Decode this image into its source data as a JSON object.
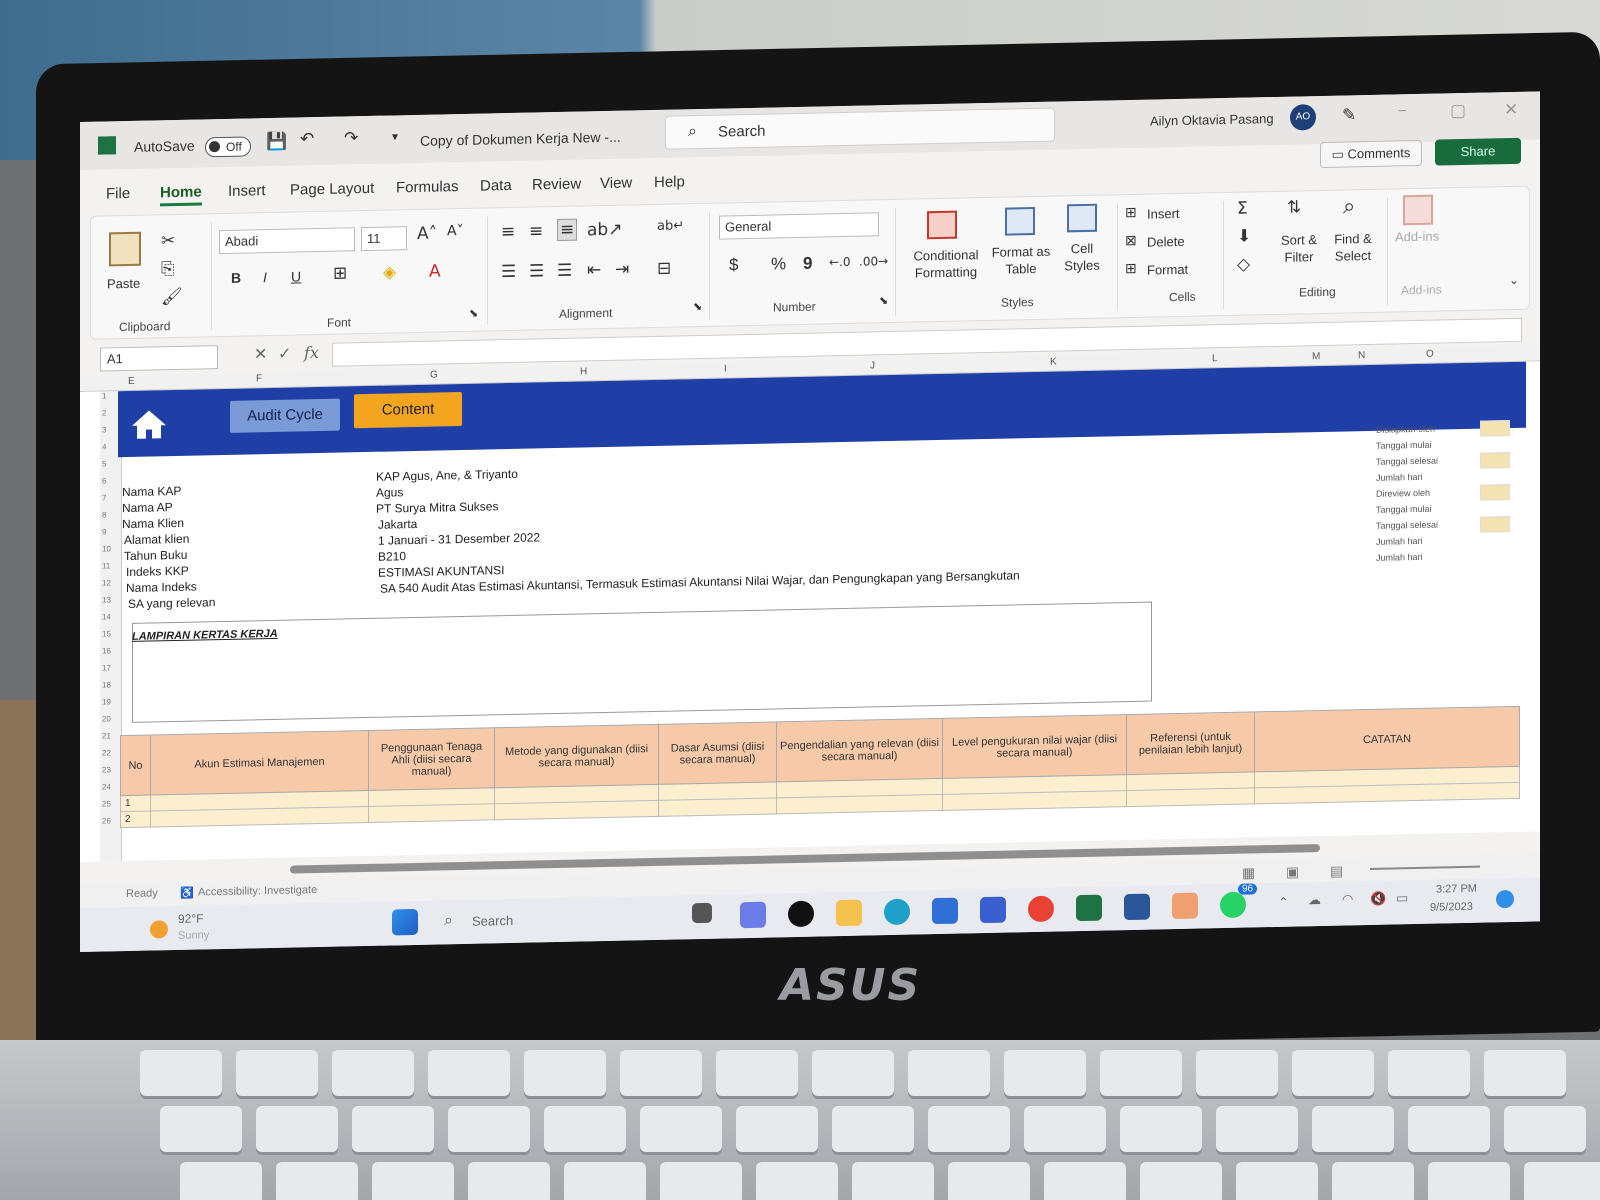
{
  "window": {
    "autosave_label": "AutoSave",
    "autosave_state": "Off",
    "doc_title": "Copy of Dokumen Kerja New  -...",
    "search_placeholder": "Search",
    "user_name": "Ailyn Oktavia Pasang",
    "user_initials": "AO",
    "comments_label": "Comments",
    "share_label": "Share"
  },
  "menu": {
    "tabs": [
      "File",
      "Home",
      "Insert",
      "Page Layout",
      "Formulas",
      "Data",
      "Review",
      "View",
      "Help"
    ],
    "active": "Home"
  },
  "ribbon": {
    "clipboard": {
      "paste_label": "Paste",
      "group_label": "Clipboard"
    },
    "font": {
      "font_name": "Abadi",
      "font_size": "11",
      "group_label": "Font",
      "bold": "B",
      "italic": "I",
      "underline": "U"
    },
    "alignment": {
      "group_label": "Alignment"
    },
    "number": {
      "format": "General",
      "group_label": "Number",
      "currency": "$",
      "percent": "%",
      "comma": "9"
    },
    "styles": {
      "conditional_formatting": "Conditional Formatting",
      "format_as_table": "Format as Table",
      "cell_styles": "Cell Styles",
      "group_label": "Styles"
    },
    "cells": {
      "insert": "Insert",
      "delete": "Delete",
      "format": "Format",
      "group_label": "Cells"
    },
    "editing": {
      "sort_filter": "Sort & Filter",
      "find_select": "Find & Select",
      "group_label": "Editing"
    },
    "addins": {
      "label": "Add-ins",
      "group_label": "Add-ins"
    }
  },
  "formula_bar": {
    "name_box": "A1",
    "fx": "fx"
  },
  "columns": [
    "E",
    "F",
    "G",
    "H",
    "I",
    "J",
    "K",
    "L",
    "M",
    "N",
    "O"
  ],
  "rows": [
    "1",
    "2",
    "3",
    "4",
    "5",
    "6",
    "7",
    "8",
    "9",
    "10",
    "11",
    "12",
    "13",
    "14",
    "15",
    "16",
    "17",
    "18",
    "19",
    "20",
    "21",
    "22",
    "23",
    "24",
    "25",
    "26"
  ],
  "sheet": {
    "nav_audit": "Audit Cycle",
    "nav_content": "Content",
    "info_labels": [
      "Nama KAP",
      "Nama AP",
      "Nama Klien",
      "Alamat klien",
      "Tahun Buku",
      "Indeks KKP",
      "Nama Indeks",
      "SA yang relevan"
    ],
    "info_values": [
      "KAP Agus, Ane, & Triyanto",
      "Agus",
      "PT Surya Mitra Sukses",
      "Jakarta",
      "1 Januari - 31 Desember 2022",
      "B210",
      "ESTIMASI AKUNTANSI",
      "SA 540   Audit Atas Estimasi Akuntansi, Termasuk Estimasi Akuntansi Nilai Wajar, dan Pengungkapan yang Bersangkutan"
    ],
    "side_labels": [
      "Disiapkan oleh",
      "Tanggal mulai",
      "Tanggal selesai",
      "Jumlah hari",
      "Direview oleh",
      "Tanggal mulai",
      "Tanggal selesai",
      "Jumlah hari",
      "Jumlah hari"
    ],
    "lampiran_title": "LAMPIRAN KERTAS KERJA",
    "table_headers": [
      "No",
      "Akun Estimasi Manajemen",
      "Penggunaan Tenaga Ahli (diisi secara manual)",
      "Metode yang digunakan (diisi secara manual)",
      "Dasar Asumsi (diisi secara manual)",
      "Pengendalian yang relevan (diisi secara manual)",
      "Level pengukuran nilai wajar (diisi secara manual)",
      "Referensi (untuk penilaian lebih lanjut)",
      "CATATAN"
    ],
    "table_rows": [
      "1",
      "2"
    ]
  },
  "status_bar": {
    "ready": "Ready",
    "accessibility": "Accessibility: Investigate"
  },
  "taskbar": {
    "weather_temp": "92°F",
    "weather_desc": "Sunny",
    "search_label": "Search",
    "whatsapp_badge": "96",
    "time": "3:27 PM",
    "date": "9/5/2023"
  },
  "laptop_brand": "ASUS"
}
